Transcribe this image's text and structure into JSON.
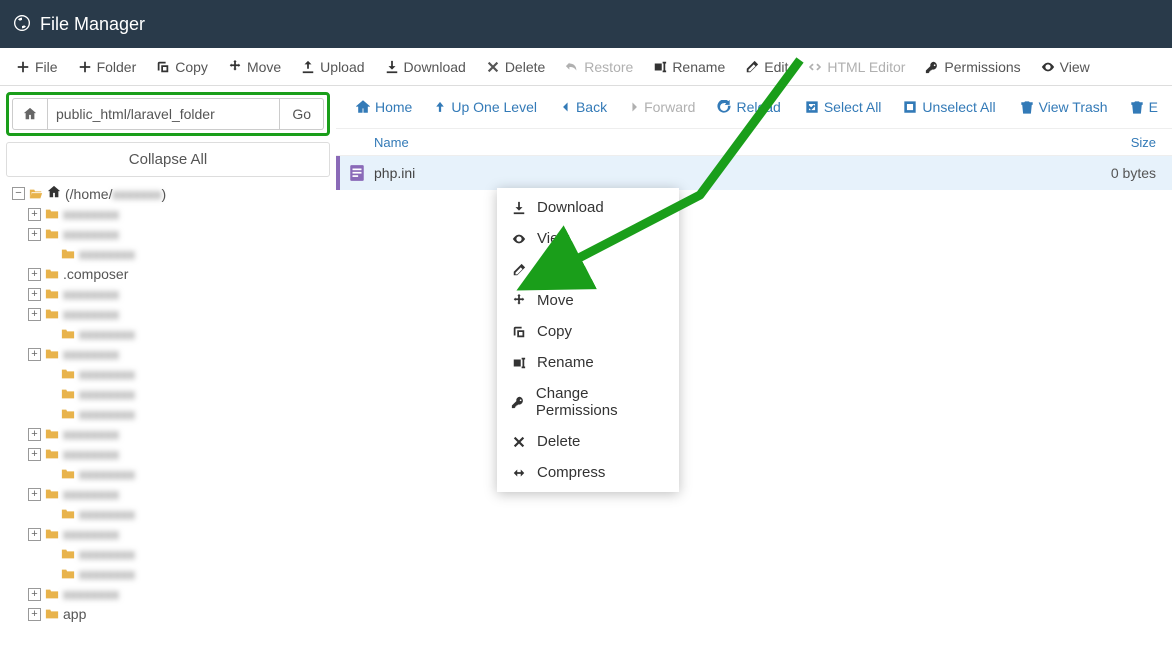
{
  "header": {
    "title": "File Manager"
  },
  "toolbar": {
    "file": "File",
    "folder": "Folder",
    "copy": "Copy",
    "move": "Move",
    "upload": "Upload",
    "download": "Download",
    "delete": "Delete",
    "restore": "Restore",
    "rename": "Rename",
    "edit": "Edit",
    "html_editor": "HTML Editor",
    "permissions": "Permissions",
    "view": "View"
  },
  "path": {
    "value": "public_html/laravel_folder",
    "go": "Go"
  },
  "collapse_all": "Collapse All",
  "tree": {
    "root_label": "(/home/",
    "items": [
      {
        "indent": 1,
        "toggle": "+",
        "label": "",
        "blur": true
      },
      {
        "indent": 1,
        "toggle": "+",
        "label": "",
        "blur": true
      },
      {
        "indent": 2,
        "toggle": "",
        "label": "",
        "blur": true
      },
      {
        "indent": 1,
        "toggle": "+",
        "label": ".composer",
        "blur": false
      },
      {
        "indent": 1,
        "toggle": "+",
        "label": "",
        "blur": true
      },
      {
        "indent": 1,
        "toggle": "+",
        "label": "",
        "blur": true
      },
      {
        "indent": 2,
        "toggle": "",
        "label": "",
        "blur": true
      },
      {
        "indent": 1,
        "toggle": "+",
        "label": "",
        "blur": true
      },
      {
        "indent": 2,
        "toggle": "",
        "label": "",
        "blur": true
      },
      {
        "indent": 2,
        "toggle": "",
        "label": "",
        "blur": true
      },
      {
        "indent": 2,
        "toggle": "",
        "label": "",
        "blur": true
      },
      {
        "indent": 1,
        "toggle": "+",
        "label": "",
        "blur": true
      },
      {
        "indent": 1,
        "toggle": "+",
        "label": "",
        "blur": true
      },
      {
        "indent": 2,
        "toggle": "",
        "label": "",
        "blur": true
      },
      {
        "indent": 1,
        "toggle": "+",
        "label": "",
        "blur": true
      },
      {
        "indent": 2,
        "toggle": "",
        "label": "",
        "blur": true
      },
      {
        "indent": 1,
        "toggle": "+",
        "label": "",
        "blur": true
      },
      {
        "indent": 2,
        "toggle": "",
        "label": "",
        "blur": true
      },
      {
        "indent": 2,
        "toggle": "",
        "label": "",
        "blur": true
      },
      {
        "indent": 1,
        "toggle": "+",
        "label": "",
        "blur": true
      },
      {
        "indent": 1,
        "toggle": "+",
        "label": "app",
        "blur": false
      }
    ]
  },
  "actions": {
    "home": "Home",
    "up": "Up One Level",
    "back": "Back",
    "forward": "Forward",
    "reload": "Reload",
    "select_all": "Select All",
    "unselect_all": "Unselect All",
    "view_trash": "View Trash",
    "empty": "E"
  },
  "list": {
    "col_name": "Name",
    "col_size": "Size",
    "rows": [
      {
        "name": "php.ini",
        "size": "0 bytes"
      }
    ]
  },
  "context": {
    "download": "Download",
    "view": "View",
    "edit": "Edit",
    "move": "Move",
    "copy": "Copy",
    "rename": "Rename",
    "permissions": "Change Permissions",
    "delete": "Delete",
    "compress": "Compress"
  }
}
